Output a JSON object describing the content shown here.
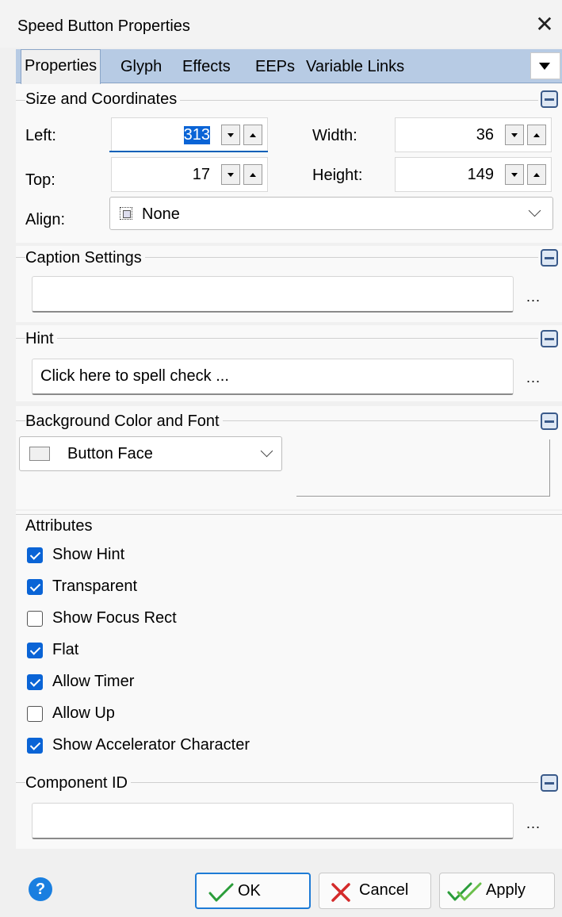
{
  "window": {
    "title": "Speed Button Properties"
  },
  "tabs": [
    "Properties",
    "Glyph",
    "Effects",
    "EEPs",
    "Variable Links"
  ],
  "size_coords": {
    "title": "Size and Coordinates",
    "left_label": "Left:",
    "left_value": "313",
    "top_label": "Top:",
    "top_value": "17",
    "width_label": "Width:",
    "width_value": "36",
    "height_label": "Height:",
    "height_value": "149",
    "align_label": "Align:",
    "align_value": "None"
  },
  "caption": {
    "title": "Caption Settings",
    "value": "",
    "ellipsis": "..."
  },
  "hint": {
    "title": "Hint",
    "value": "Click here to spell check ...",
    "ellipsis": "..."
  },
  "background": {
    "title": "Background Color and Font",
    "color_value": "Button Face"
  },
  "attributes": {
    "title": "Attributes",
    "items": [
      {
        "label": "Show Hint",
        "checked": true
      },
      {
        "label": "Transparent",
        "checked": true
      },
      {
        "label": "Show Focus Rect",
        "checked": false
      },
      {
        "label": "Flat",
        "checked": true
      },
      {
        "label": "Allow Timer",
        "checked": true
      },
      {
        "label": "Allow Up",
        "checked": false
      },
      {
        "label": "Show Accelerator Character",
        "checked": true
      }
    ]
  },
  "component": {
    "title": "Component ID",
    "value": "",
    "ellipsis": "..."
  },
  "footer": {
    "help": "?",
    "ok": "OK",
    "cancel": "Cancel",
    "apply": "Apply"
  },
  "colors": {
    "accent": "#0a64d6",
    "tabstrip": "#b7cbe4",
    "ok_check": "#2a9d3a",
    "cancel_x": "#d42a2a"
  }
}
